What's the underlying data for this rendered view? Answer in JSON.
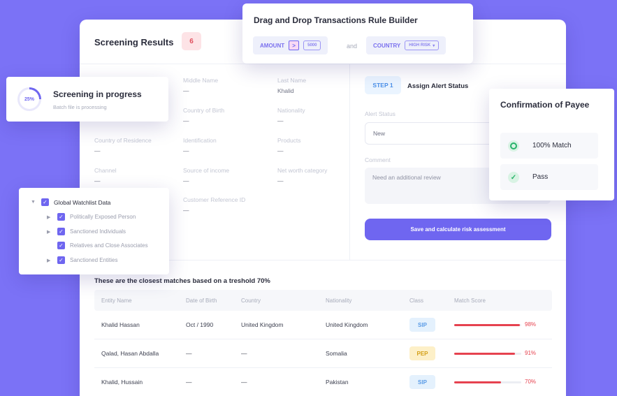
{
  "screening": {
    "title": "Screening Results",
    "count": "6",
    "fields": [
      {
        "label": "Middle Name",
        "value": "—"
      },
      {
        "label": "Last Name",
        "value": "Khalid"
      },
      {
        "label": "Country of Birth",
        "value": "—"
      },
      {
        "label": "Nationality",
        "value": "—"
      },
      {
        "label": "Country of Residence",
        "value": "—"
      },
      {
        "label": "Identification",
        "value": "—"
      },
      {
        "label": "Products",
        "value": "—"
      },
      {
        "label": "Channel",
        "value": "—"
      },
      {
        "label": "Source of income",
        "value": "—"
      },
      {
        "label": "Net worth category",
        "value": "—"
      },
      {
        "label": "Customer Reference ID",
        "value": "—"
      }
    ],
    "step": {
      "chip": "STEP 1",
      "title": "Assign Alert Status",
      "alert_label": "Alert Status",
      "alert_value": "New",
      "comment_label": "Comment",
      "comment_value": "Need an additional review",
      "save_label": "Save and calculate risk assessment"
    },
    "matches_title": "These are the closest matches based on a treshold 70%",
    "columns": [
      "Entity Name",
      "Date of Birth",
      "Country",
      "Nationality",
      "Class",
      "Match Score"
    ],
    "rows": [
      {
        "name": "Khalid Hassan",
        "dob": "Oct / 1990",
        "country": "United Kingdom",
        "nationality": "United Kingdom",
        "class": "SIP",
        "score": "98%",
        "score_value": 98
      },
      {
        "name": "Qalad, Hasan Abdalla",
        "dob": "—",
        "country": "—",
        "nationality": "Somalia",
        "class": "PEP",
        "score": "91%",
        "score_value": 91
      },
      {
        "name": "Khalid, Hussain",
        "dob": "—",
        "country": "—",
        "nationality": "Pakistan",
        "class": "SIP",
        "score": "70%",
        "score_value": 70
      }
    ]
  },
  "rule_builder": {
    "title": "Drag and Drop Transactions Rule Builder",
    "amount_label": "AMOUNT",
    "operator": ">",
    "amount_value": "5000",
    "and_label": "and",
    "country_label": "COUNTRY",
    "country_value": "HIGH RISK"
  },
  "progress": {
    "percent": "25%",
    "percent_value": 25,
    "title": "Screening in progress",
    "subtitle": "Batch file is processing"
  },
  "watchlist": {
    "root": "Global Watchlist Data",
    "items": [
      "Politically Exposed Person",
      "Sanctioned Individuals",
      "Relatives and Close Associates",
      "Sanctioned Entities"
    ]
  },
  "confirmation": {
    "title": "Confirmation of Payee",
    "match_label": "100% Match",
    "pass_label": "Pass"
  },
  "colors": {
    "background": "#7b72f6",
    "accent": "#6f66f0",
    "danger": "#e6424f",
    "sip_bg": "#e4f1fd",
    "sip_text": "#5a9be6",
    "pep_bg": "#fdf0c8",
    "pep_text": "#d4a017",
    "success": "#27b36a"
  }
}
